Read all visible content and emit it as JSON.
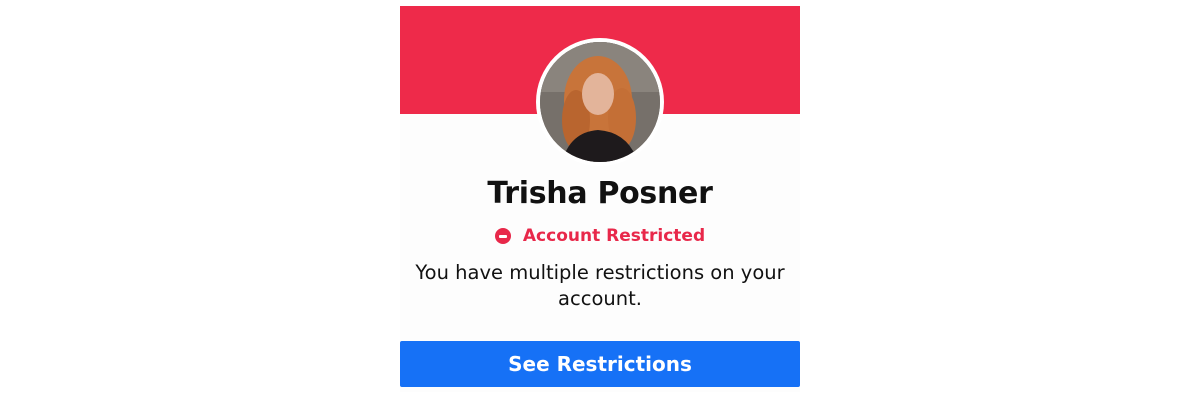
{
  "profile": {
    "name": "Trisha Posner",
    "avatar_alt": "profile photo"
  },
  "status": {
    "icon": "no-entry-icon",
    "label": "Account Restricted",
    "color": "#e8284a"
  },
  "message": "You have multiple restrictions on your account.",
  "actions": {
    "see_restrictions_label": "See Restrictions"
  },
  "colors": {
    "banner": "#ee2a4a",
    "button": "#1671f6",
    "alert": "#e8284a"
  }
}
